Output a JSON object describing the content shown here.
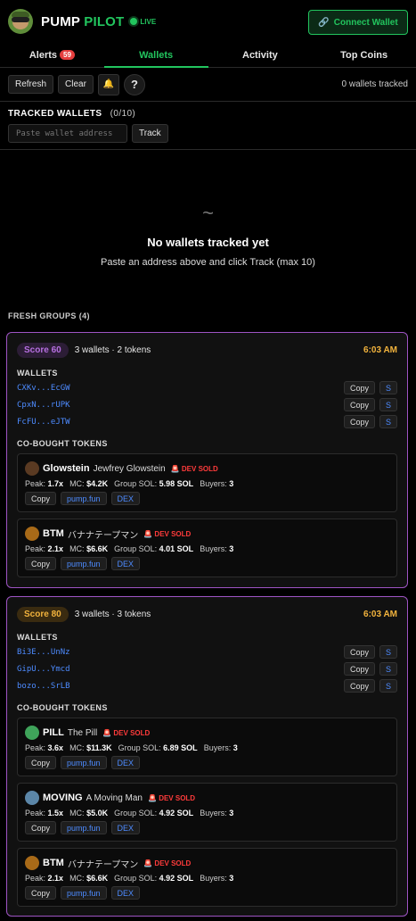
{
  "header": {
    "brand_a": "PUMP",
    "brand_b": "PILOT",
    "live": "LIVE",
    "connect": "Connect Wallet"
  },
  "tabs": [
    {
      "label": "Alerts",
      "badge": "59"
    },
    {
      "label": "Wallets"
    },
    {
      "label": "Activity"
    },
    {
      "label": "Top Coins"
    }
  ],
  "toolbar": {
    "refresh": "Refresh",
    "clear": "Clear",
    "bell": "🔔",
    "help": "?",
    "count": "0 wallets tracked"
  },
  "tracked": {
    "title": "TRACKED WALLETS",
    "count": "(0/10)",
    "placeholder": "Paste wallet address",
    "track": "Track"
  },
  "empty": {
    "icon": "~",
    "title": "No wallets tracked yet",
    "subtitle": "Paste an address above and click Track (max 10)"
  },
  "fresh": "FRESH GROUPS (4)",
  "labels": {
    "wallets": "WALLETS",
    "cobought": "CO-BOUGHT TOKENS",
    "copy": "Copy",
    "s": "S",
    "pump": "pump.fun",
    "dex": "DEX",
    "peak": "Peak:",
    "mc": "MC:",
    "gsol": "Group SOL:",
    "buyers": "Buyers:",
    "dev": "DEV SOLD"
  },
  "groups": [
    {
      "score": "Score 60",
      "meta": "3 wallets · 2 tokens",
      "time": "6:03 AM",
      "wallets": [
        "CXKv...EcGW",
        "CpxN...rUPK",
        "FcFU...eJTW"
      ],
      "tokens": [
        {
          "sym": "Glowstein",
          "name": "Jewfrey Glowstein",
          "peak": "1.7x",
          "mc": "$4.2K",
          "gsol": "5.98 SOL",
          "buyers": "3",
          "avatar_color": "#5a3a22"
        },
        {
          "sym": "BTM",
          "name": "バナナテープマン",
          "peak": "2.1x",
          "mc": "$6.6K",
          "gsol": "4.01 SOL",
          "buyers": "3",
          "avatar_color": "#a86a18"
        }
      ]
    },
    {
      "score": "Score 80",
      "meta": "3 wallets · 3 tokens",
      "time": "6:03 AM",
      "wallets": [
        "Bi3E...UnNz",
        "GipU...Ymcd",
        "bozo...SrLB"
      ],
      "tokens": [
        {
          "sym": "PILL",
          "name": "The Pill",
          "peak": "3.6x",
          "mc": "$11.3K",
          "gsol": "6.89 SOL",
          "buyers": "3",
          "avatar_color": "#3fa35a"
        },
        {
          "sym": "MOVING",
          "name": "A Moving Man",
          "peak": "1.5x",
          "mc": "$5.0K",
          "gsol": "4.92 SOL",
          "buyers": "3",
          "avatar_color": "#5b86a8"
        },
        {
          "sym": "BTM",
          "name": "バナナテープマン",
          "peak": "2.1x",
          "mc": "$6.6K",
          "gsol": "4.92 SOL",
          "buyers": "3",
          "avatar_color": "#a86a18"
        }
      ]
    }
  ]
}
